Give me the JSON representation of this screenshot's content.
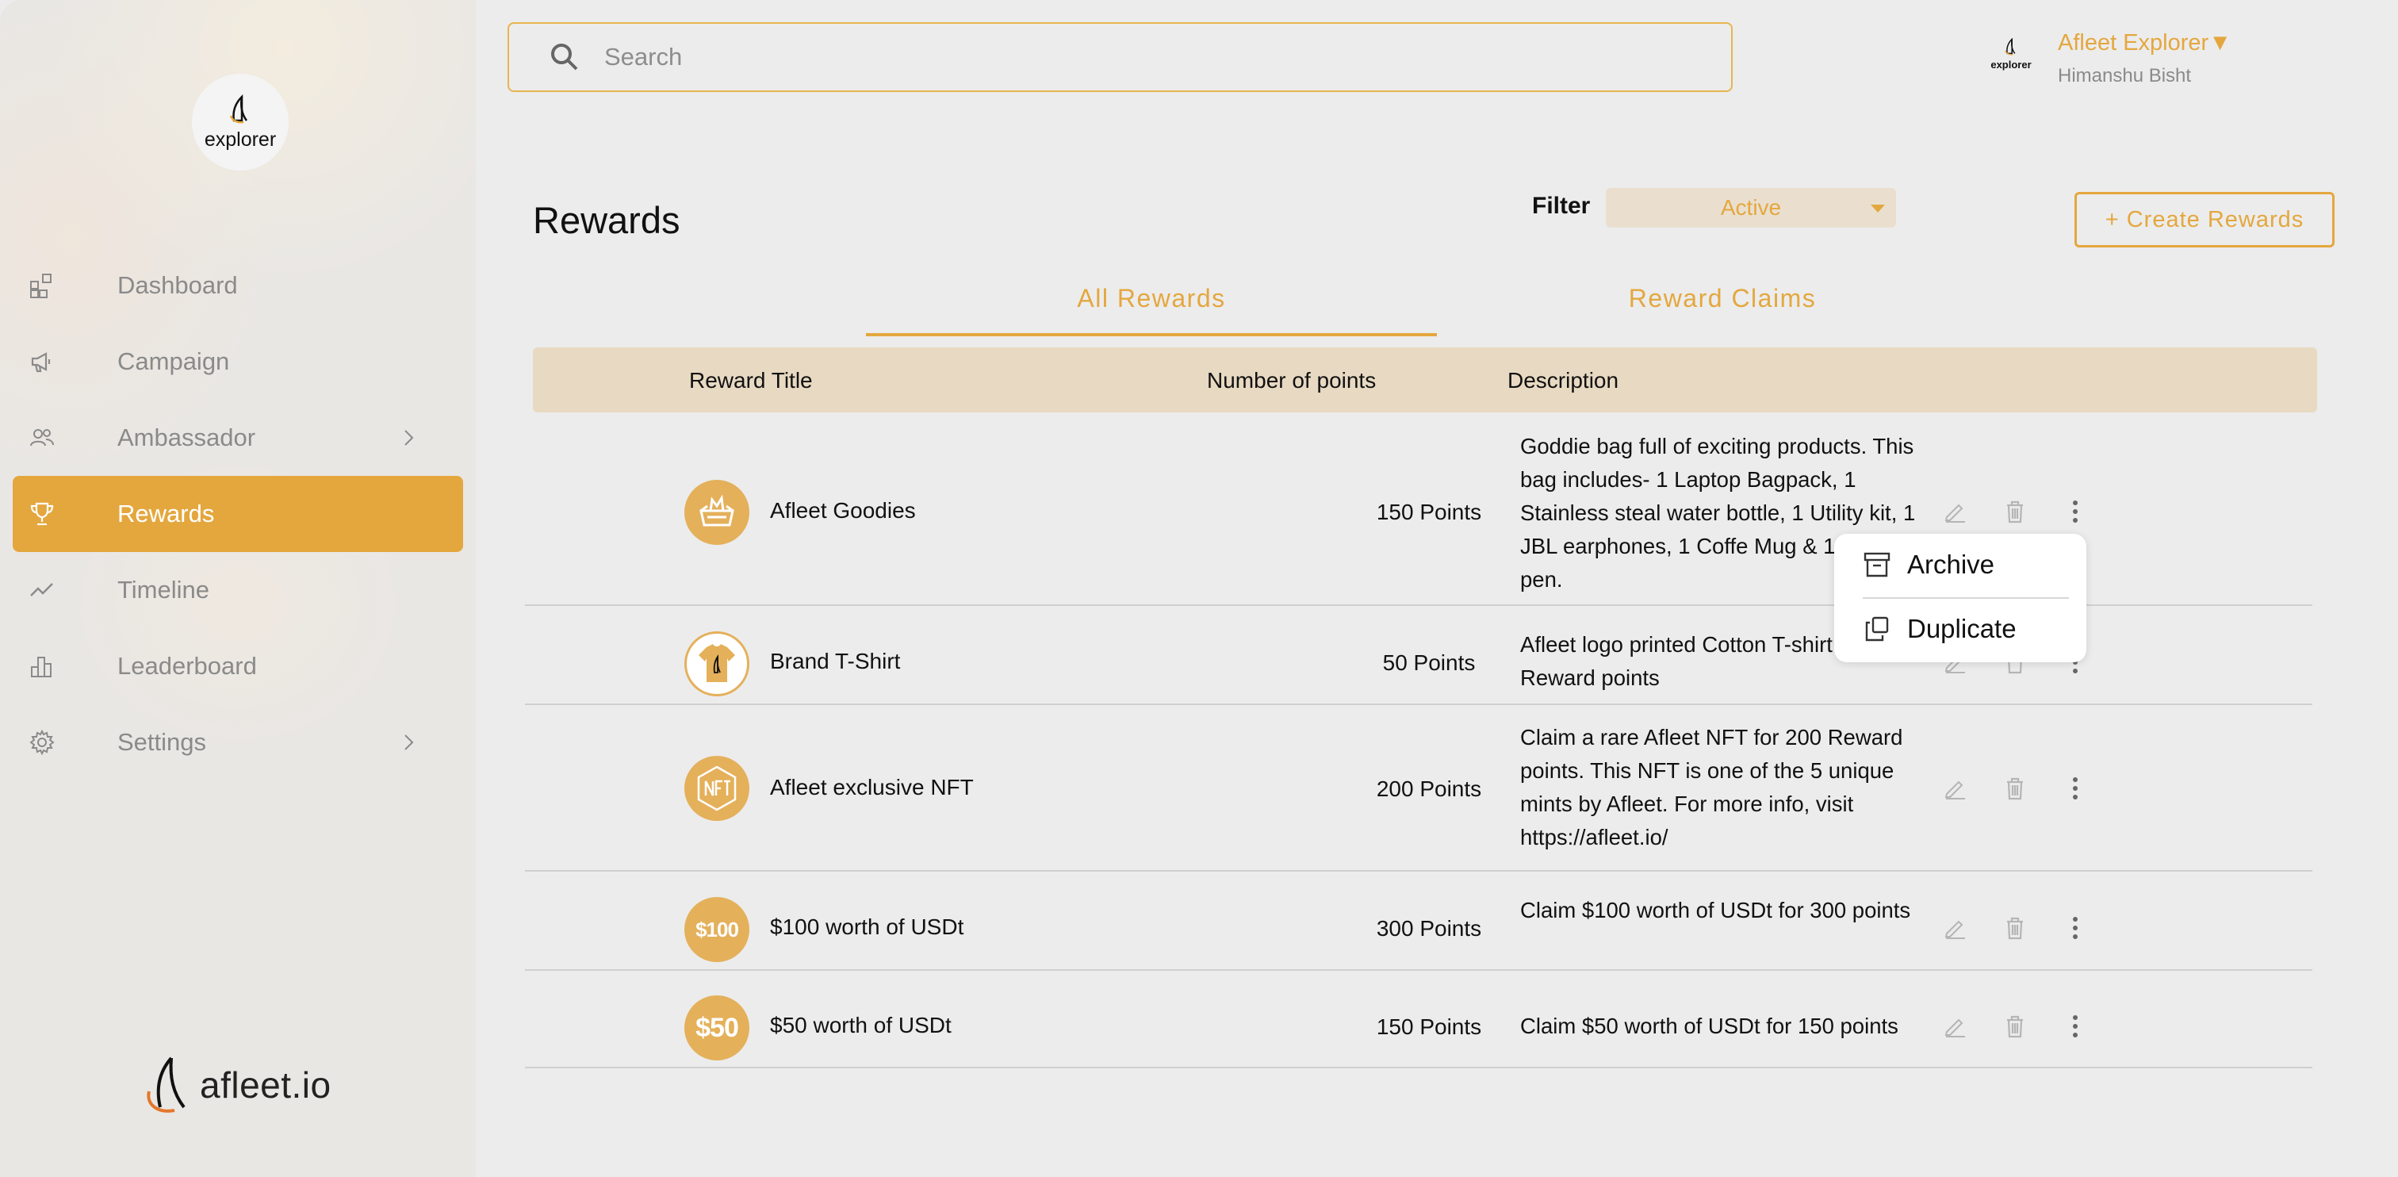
{
  "brand": {
    "logo_text": "explorer",
    "footer_logo_text": "afleet.io"
  },
  "sidebar": {
    "items": [
      {
        "label": "Dashboard",
        "icon": "dashboard-icon",
        "active": false,
        "chevron": false
      },
      {
        "label": "Campaign",
        "icon": "megaphone-icon",
        "active": false,
        "chevron": false
      },
      {
        "label": "Ambassador",
        "icon": "users-icon",
        "active": false,
        "chevron": true
      },
      {
        "label": "Rewards",
        "icon": "trophy-icon",
        "active": true,
        "chevron": false
      },
      {
        "label": "Timeline",
        "icon": "trend-icon",
        "active": false,
        "chevron": false
      },
      {
        "label": "Leaderboard",
        "icon": "bar-chart-icon",
        "active": false,
        "chevron": false
      },
      {
        "label": "Settings",
        "icon": "gear-icon",
        "active": false,
        "chevron": true
      }
    ]
  },
  "search": {
    "placeholder": "Search",
    "value": ""
  },
  "user": {
    "avatar_text": "explorer",
    "name": "Afleet Explorer▼",
    "subtitle": "Himanshu Bisht"
  },
  "page": {
    "title": "Rewards",
    "filter_label": "Filter",
    "filter_value": "Active",
    "create_button": "+ Create Rewards"
  },
  "tabs": [
    {
      "label": "All Rewards",
      "active": true
    },
    {
      "label": "Reward Claims",
      "active": false
    }
  ],
  "table": {
    "headers": [
      "Reward Title",
      "Number of points",
      "Description"
    ],
    "rows": [
      {
        "title": "Afleet Goodies",
        "points": "150 Points",
        "icon": "goodie-basket-icon",
        "description": "Goddie bag full of exciting products. This bag includes- 1 Laptop Bagpack, 1 Stainless steal water bottle, 1 Utility kit, 1 JBL earphones, 1 Coffe Mug & 1 Ball point pen."
      },
      {
        "title": "Brand T-Shirt",
        "points": "50 Points",
        "icon": "tshirt-icon",
        "description": "Afleet logo printed Cotton T-shirt for 50 Reward points"
      },
      {
        "title": "Afleet exclusive NFT",
        "points": "200 Points",
        "icon": "nft-icon",
        "description": "Claim a rare Afleet NFT for 200 Reward points. This NFT is one of the 5 unique mints by Afleet. For more info, visit https://afleet.io/"
      },
      {
        "title": "$100 worth of USDt",
        "points": "300 Points",
        "icon": "usd-100-icon",
        "icon_text": "$100",
        "description": "Claim $100 worth of USDt for 300 points"
      },
      {
        "title": "$50 worth of USDt",
        "points": "150 Points",
        "icon": "usd-50-icon",
        "icon_text": "$50",
        "description": "Claim $50 worth of USDt for 150 points"
      }
    ]
  },
  "context_menu": {
    "items": [
      "Archive",
      "Duplicate"
    ]
  },
  "colors": {
    "accent": "#e4a73e",
    "header_bg": "#e8d9c2",
    "page_bg": "#ececec"
  }
}
